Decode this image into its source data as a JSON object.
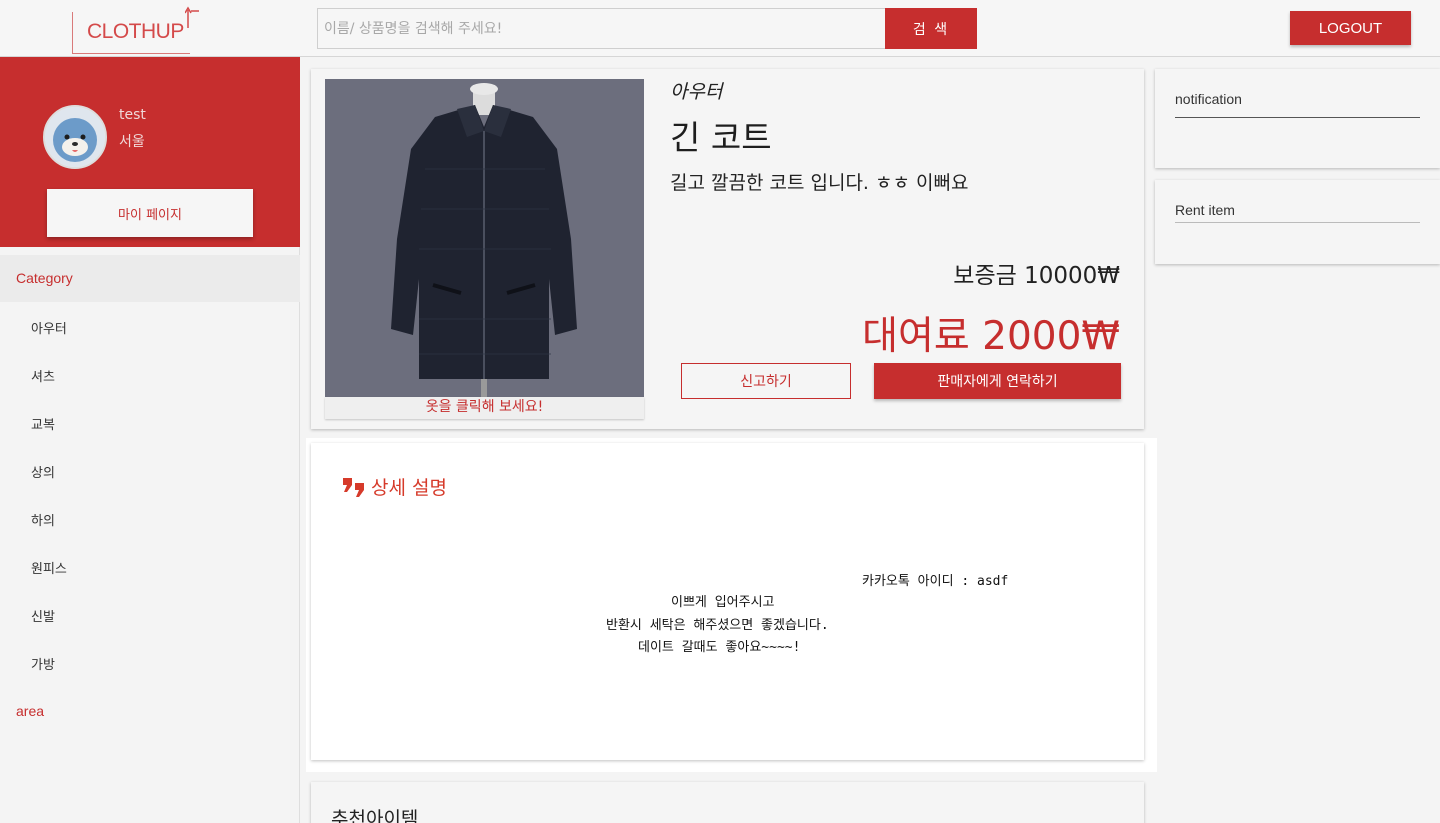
{
  "header": {
    "logo": "CLOTHUP",
    "search_placeholder": "이름/ 상품명을 검색해 주세요!",
    "search_button": "검 색",
    "logout_button": "LOGOUT"
  },
  "sidebar": {
    "user_name": "test",
    "user_region": "서울",
    "mypage_button": "마이 페이지",
    "category_header": "Category",
    "categories": [
      "아우터",
      "셔츠",
      "교복",
      "상의",
      "하의",
      "원피스",
      "신발",
      "가방"
    ],
    "area_label": "area"
  },
  "product": {
    "category": "아우터",
    "title": "긴 코트",
    "description": "길고 깔끔한 코트 입니다. ㅎㅎ 이뻐요",
    "deposit": "보증금 10000₩",
    "fee": "대여료 2000₩",
    "photo_caption": "옷을 클릭해 보세요!",
    "report_button": "신고하기",
    "contact_button": "판매자에게 연락하기"
  },
  "widgets": {
    "notification_title": "notification",
    "rent_title": "Rent item"
  },
  "detail": {
    "title": "상세 설명",
    "lines": [
      "카카오톡 아이디 : asdf",
      "이쁘게 입어주시고",
      "반환시 세탁은 해주셨으면 좋겠습니다.",
      "데이트 갈때도 좋아요~~~~!"
    ]
  },
  "recommend": {
    "title": "추천아이템"
  },
  "colors": {
    "accent": "#c62e2e",
    "detail_title": "#d63a2a"
  }
}
